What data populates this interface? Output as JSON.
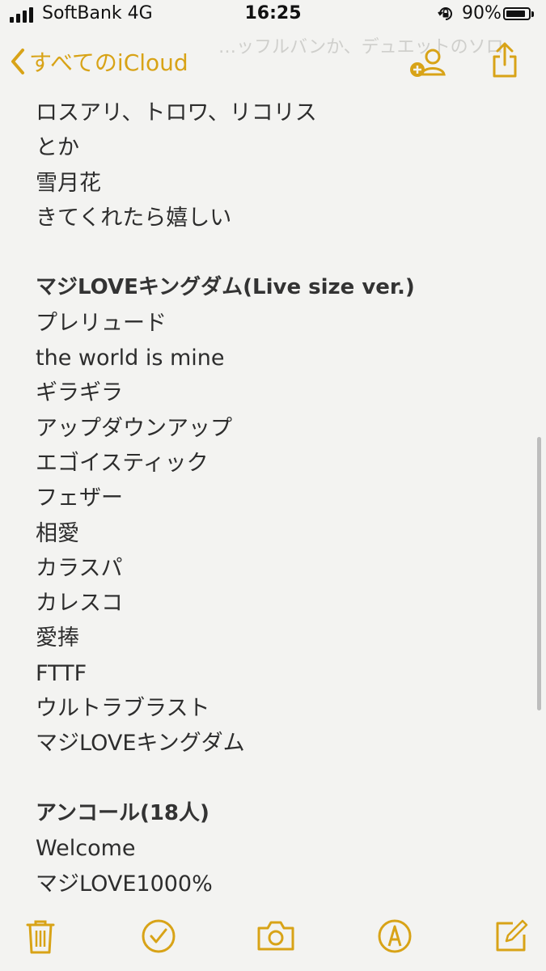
{
  "status_bar": {
    "carrier": "SoftBank 4G",
    "time": "16:25",
    "battery_percent": "90%",
    "battery_level": 0.9,
    "signal_bars": 4
  },
  "nav": {
    "back_label": "すべてのiCloud",
    "ghost_title": "…ッフルバンか、デュエットのソロ",
    "accent_color": "#d8a317"
  },
  "note": {
    "lines": [
      {
        "text": "ロスアリ、トロワ、リコリス",
        "style": "normal"
      },
      {
        "text": "とか",
        "style": "normal"
      },
      {
        "text": "雪月花",
        "style": "normal"
      },
      {
        "text": "きてくれたら嬉しい",
        "style": "normal"
      },
      {
        "text": "",
        "style": "blank"
      },
      {
        "text": "マジLOVEキングダム(Live size ver.)",
        "style": "heading"
      },
      {
        "text": "プレリュード",
        "style": "normal"
      },
      {
        "text": "the world is mine",
        "style": "normal"
      },
      {
        "text": "ギラギラ",
        "style": "normal"
      },
      {
        "text": "アップダウンアップ",
        "style": "normal"
      },
      {
        "text": "エゴイスティック",
        "style": "normal"
      },
      {
        "text": "フェザー",
        "style": "normal"
      },
      {
        "text": "相愛",
        "style": "normal"
      },
      {
        "text": "カラスパ",
        "style": "normal"
      },
      {
        "text": "カレスコ",
        "style": "normal"
      },
      {
        "text": "愛捧",
        "style": "normal"
      },
      {
        "text": "FTTF",
        "style": "normal"
      },
      {
        "text": "ウルトラブラスト",
        "style": "normal"
      },
      {
        "text": "マジLOVEキングダム",
        "style": "normal"
      },
      {
        "text": "",
        "style": "blank"
      },
      {
        "text": "アンコール(18人)",
        "style": "heading"
      },
      {
        "text": "Welcome",
        "style": "normal"
      },
      {
        "text": "マジLOVE1000%",
        "style": "normal"
      }
    ]
  },
  "toolbar": {
    "icons": [
      "trash-icon",
      "checklist-icon",
      "camera-icon",
      "markup-icon",
      "compose-icon"
    ]
  }
}
